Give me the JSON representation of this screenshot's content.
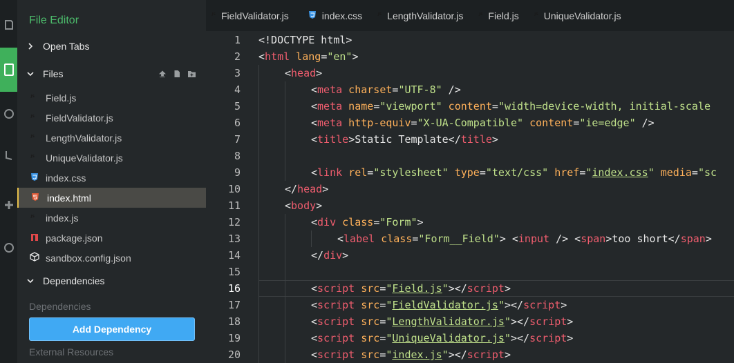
{
  "sidebar": {
    "title": "File Editor",
    "sections": {
      "open_tabs": "Open Tabs",
      "files": "Files",
      "dependencies": "Dependencies"
    },
    "files": [
      {
        "name": "Field.js",
        "type": "js"
      },
      {
        "name": "FieldValidator.js",
        "type": "js"
      },
      {
        "name": "LengthValidator.js",
        "type": "js"
      },
      {
        "name": "UniqueValidator.js",
        "type": "js"
      },
      {
        "name": "index.css",
        "type": "css"
      },
      {
        "name": "index.html",
        "type": "html",
        "active": true
      },
      {
        "name": "index.js",
        "type": "js"
      },
      {
        "name": "package.json",
        "type": "json"
      },
      {
        "name": "sandbox.config.json",
        "type": "config"
      }
    ],
    "dependencies_label": "Dependencies",
    "add_dependency": "Add Dependency",
    "external_resources": "External Resources"
  },
  "tabs": [
    {
      "name": "FieldValidator.js",
      "type": "js"
    },
    {
      "name": "index.css",
      "type": "css"
    },
    {
      "name": "LengthValidator.js",
      "type": "js"
    },
    {
      "name": "Field.js",
      "type": "js"
    },
    {
      "name": "UniqueValidator.js",
      "type": "js"
    }
  ],
  "editor": {
    "current_line": 16,
    "lines": [
      {
        "n": "1",
        "i": 0,
        "seg": [
          [
            "p",
            "<!DOCTYPE html>"
          ]
        ]
      },
      {
        "n": "2",
        "i": 0,
        "seg": [
          [
            "p",
            "<"
          ],
          [
            "t",
            "html"
          ],
          [
            "a",
            " lang"
          ],
          [
            "p",
            "="
          ],
          [
            "s",
            "\"en\""
          ],
          [
            "p",
            ">"
          ]
        ]
      },
      {
        "n": "3",
        "i": 1,
        "seg": [
          [
            "p",
            "<"
          ],
          [
            "t",
            "head"
          ],
          [
            "p",
            ">"
          ]
        ]
      },
      {
        "n": "4",
        "i": 2,
        "seg": [
          [
            "p",
            "<"
          ],
          [
            "t",
            "meta"
          ],
          [
            "a",
            " charset"
          ],
          [
            "p",
            "="
          ],
          [
            "s",
            "\"UTF-8\""
          ],
          [
            "p",
            " />"
          ]
        ]
      },
      {
        "n": "5",
        "i": 2,
        "seg": [
          [
            "p",
            "<"
          ],
          [
            "t",
            "meta"
          ],
          [
            "a",
            " name"
          ],
          [
            "p",
            "="
          ],
          [
            "s",
            "\"viewport\""
          ],
          [
            "a",
            " content"
          ],
          [
            "p",
            "="
          ],
          [
            "s",
            "\"width=device-width, initial-scale"
          ]
        ]
      },
      {
        "n": "6",
        "i": 2,
        "seg": [
          [
            "p",
            "<"
          ],
          [
            "t",
            "meta"
          ],
          [
            "a",
            " http-equiv"
          ],
          [
            "p",
            "="
          ],
          [
            "s",
            "\"X-UA-Compatible\""
          ],
          [
            "a",
            " content"
          ],
          [
            "p",
            "="
          ],
          [
            "s",
            "\"ie=edge\""
          ],
          [
            "p",
            " />"
          ]
        ]
      },
      {
        "n": "7",
        "i": 2,
        "seg": [
          [
            "p",
            "<"
          ],
          [
            "t",
            "title"
          ],
          [
            "p",
            ">Static Template</"
          ],
          [
            "t",
            "title"
          ],
          [
            "p",
            ">"
          ]
        ]
      },
      {
        "n": "8",
        "i": 2,
        "seg": []
      },
      {
        "n": "9",
        "i": 2,
        "seg": [
          [
            "p",
            "<"
          ],
          [
            "t",
            "link"
          ],
          [
            "a",
            " rel"
          ],
          [
            "p",
            "="
          ],
          [
            "s",
            "\"stylesheet\""
          ],
          [
            "a",
            " type"
          ],
          [
            "p",
            "="
          ],
          [
            "s",
            "\"text/css\""
          ],
          [
            "a",
            " href"
          ],
          [
            "p",
            "="
          ],
          [
            "s",
            "\""
          ],
          [
            "u",
            "index.css"
          ],
          [
            "s",
            "\""
          ],
          [
            "a",
            " media"
          ],
          [
            "p",
            "="
          ],
          [
            "s",
            "\"sc"
          ]
        ]
      },
      {
        "n": "10",
        "i": 1,
        "seg": [
          [
            "p",
            "</"
          ],
          [
            "t",
            "head"
          ],
          [
            "p",
            ">"
          ]
        ]
      },
      {
        "n": "11",
        "i": 1,
        "seg": [
          [
            "p",
            "<"
          ],
          [
            "t",
            "body"
          ],
          [
            "p",
            ">"
          ]
        ]
      },
      {
        "n": "12",
        "i": 2,
        "seg": [
          [
            "p",
            "<"
          ],
          [
            "t",
            "div"
          ],
          [
            "a",
            " class"
          ],
          [
            "p",
            "="
          ],
          [
            "s",
            "\"Form\""
          ],
          [
            "p",
            ">"
          ]
        ]
      },
      {
        "n": "13",
        "i": 3,
        "seg": [
          [
            "p",
            "<"
          ],
          [
            "t",
            "label"
          ],
          [
            "a",
            " class"
          ],
          [
            "p",
            "="
          ],
          [
            "s",
            "\"Form__Field\""
          ],
          [
            "p",
            "> <"
          ],
          [
            "t",
            "input"
          ],
          [
            "p",
            " /> <"
          ],
          [
            "t",
            "span"
          ],
          [
            "p",
            ">too short</"
          ],
          [
            "t",
            "span"
          ],
          [
            "p",
            ">"
          ]
        ]
      },
      {
        "n": "14",
        "i": 2,
        "seg": [
          [
            "p",
            "</"
          ],
          [
            "t",
            "div"
          ],
          [
            "p",
            ">"
          ]
        ]
      },
      {
        "n": "15",
        "i": 2,
        "seg": []
      },
      {
        "n": "16",
        "i": 2,
        "seg": [
          [
            "p",
            "<"
          ],
          [
            "t",
            "script"
          ],
          [
            "a",
            " src"
          ],
          [
            "p",
            "="
          ],
          [
            "s",
            "\""
          ],
          [
            "u",
            "Field.js"
          ],
          [
            "s",
            "\""
          ],
          [
            "p",
            "></"
          ],
          [
            "t",
            "script"
          ],
          [
            "p",
            ">"
          ]
        ]
      },
      {
        "n": "17",
        "i": 2,
        "seg": [
          [
            "p",
            "<"
          ],
          [
            "t",
            "script"
          ],
          [
            "a",
            " src"
          ],
          [
            "p",
            "="
          ],
          [
            "s",
            "\""
          ],
          [
            "u",
            "FieldValidator.js"
          ],
          [
            "s",
            "\""
          ],
          [
            "p",
            "></"
          ],
          [
            "t",
            "script"
          ],
          [
            "p",
            ">"
          ]
        ]
      },
      {
        "n": "18",
        "i": 2,
        "seg": [
          [
            "p",
            "<"
          ],
          [
            "t",
            "script"
          ],
          [
            "a",
            " src"
          ],
          [
            "p",
            "="
          ],
          [
            "s",
            "\""
          ],
          [
            "u",
            "LengthValidator.js"
          ],
          [
            "s",
            "\""
          ],
          [
            "p",
            "></"
          ],
          [
            "t",
            "script"
          ],
          [
            "p",
            ">"
          ]
        ]
      },
      {
        "n": "19",
        "i": 2,
        "seg": [
          [
            "p",
            "<"
          ],
          [
            "t",
            "script"
          ],
          [
            "a",
            " src"
          ],
          [
            "p",
            "="
          ],
          [
            "s",
            "\""
          ],
          [
            "u",
            "UniqueValidator.js"
          ],
          [
            "s",
            "\""
          ],
          [
            "p",
            "></"
          ],
          [
            "t",
            "script"
          ],
          [
            "p",
            ">"
          ]
        ]
      },
      {
        "n": "20",
        "i": 2,
        "seg": [
          [
            "p",
            "<"
          ],
          [
            "t",
            "script"
          ],
          [
            "a",
            " src"
          ],
          [
            "p",
            "="
          ],
          [
            "s",
            "\""
          ],
          [
            "u",
            "index.js"
          ],
          [
            "s",
            "\""
          ],
          [
            "p",
            "></"
          ],
          [
            "t",
            "script"
          ],
          [
            "p",
            ">"
          ]
        ]
      }
    ]
  },
  "colors": {
    "accent_green": "#3fb05b",
    "title_green": "#4cbb6b",
    "button_blue": "#40a9f3",
    "js_yellow": "#e8c14a",
    "css_blue": "#3b95e6",
    "html_orange": "#e35c38",
    "json_red": "#e0484a",
    "tag": "#ef5d6e",
    "attr": "#ffb15a",
    "string": "#bfe08a"
  }
}
